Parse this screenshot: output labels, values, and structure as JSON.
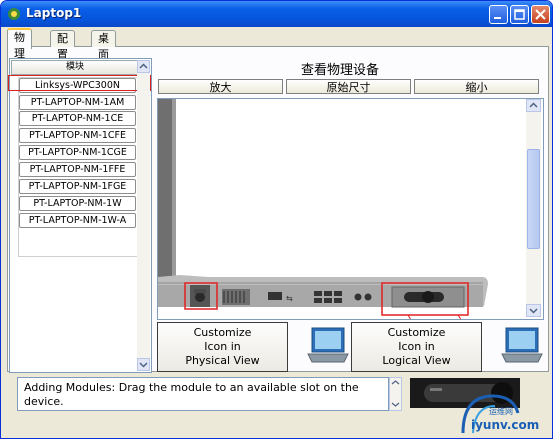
{
  "window": {
    "title": "Laptop1"
  },
  "tabs": [
    "物理",
    "配置",
    "桌面"
  ],
  "modules": {
    "header": "模块",
    "items": [
      "Linksys-WPC300N",
      "PT-LAPTOP-NM-1AM",
      "PT-LAPTOP-NM-1CE",
      "PT-LAPTOP-NM-1CFE",
      "PT-LAPTOP-NM-1CGE",
      "PT-LAPTOP-NM-1FFE",
      "PT-LAPTOP-NM-1FGE",
      "PT-LAPTOP-NM-1W",
      "PT-LAPTOP-NM-1W-A"
    ]
  },
  "physical": {
    "title": "查看物理设备",
    "zoom_in": "放大",
    "original_size": "原始尺寸",
    "zoom_out": "缩小"
  },
  "customize": {
    "physical": [
      "Customize",
      "Icon in",
      "Physical View"
    ],
    "logical": [
      "Customize",
      "Icon in",
      "Logical View"
    ]
  },
  "message": "Adding Modules: Drag the module to an available slot on the device.",
  "watermark": {
    "cn": "运维网",
    "url": "iyunv.com"
  }
}
